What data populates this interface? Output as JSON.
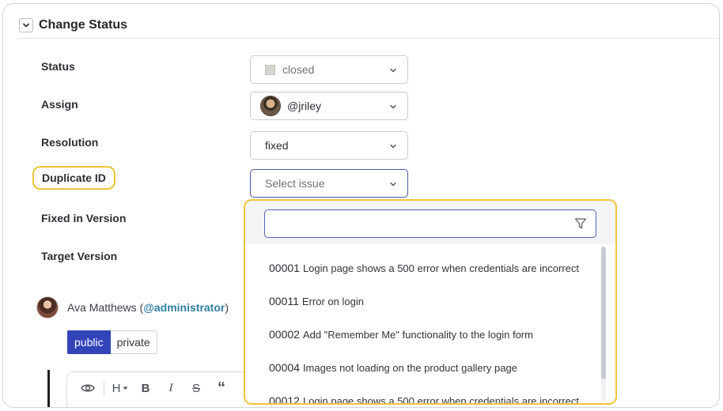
{
  "section": {
    "title": "Change Status"
  },
  "fields": {
    "status": {
      "label": "Status",
      "value": "closed"
    },
    "assign": {
      "label": "Assign",
      "value": "@jriley"
    },
    "resolution": {
      "label": "Resolution",
      "value": "fixed"
    },
    "duplicate": {
      "label": "Duplicate ID",
      "placeholder": "Select issue"
    },
    "fixed_version": {
      "label": "Fixed in Version"
    },
    "target_version": {
      "label": "Target Version"
    }
  },
  "dropdown": {
    "search_value": "",
    "items": [
      {
        "id": "00001",
        "title": "Login page shows a 500 error when credentials are incorrect"
      },
      {
        "id": "00011",
        "title": "Error on login"
      },
      {
        "id": "00002",
        "title": "Add \"Remember Me\" functionality to the login form"
      },
      {
        "id": "00004",
        "title": "Images not loading on the product gallery page"
      },
      {
        "id": "00012",
        "title": "Login page shows a 500 error when credentials are incorrect"
      }
    ]
  },
  "comment": {
    "name": "Ava Matthews",
    "handle": "@administrator",
    "visibility": {
      "public": "public",
      "private": "private"
    }
  },
  "toolbar": {
    "heading": "H",
    "bold": "B",
    "italic": "I",
    "strike": "S",
    "quote": "“"
  },
  "colors": {
    "accent": "#3344b8",
    "highlight": "#f0c43a",
    "link": "#2f7f9e"
  }
}
